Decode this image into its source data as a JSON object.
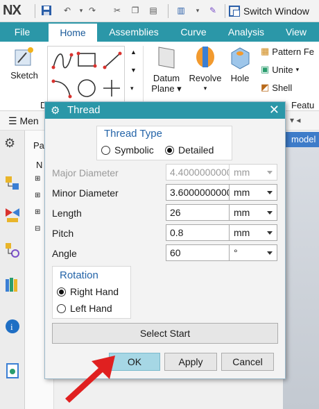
{
  "app": {
    "logo": "NX",
    "switch_window": "Switch Window"
  },
  "tabs": [
    {
      "label": "File",
      "active": false
    },
    {
      "label": "Home",
      "active": true
    },
    {
      "label": "Assemblies",
      "active": false
    },
    {
      "label": "Curve",
      "active": false
    },
    {
      "label": "Analysis",
      "active": false
    },
    {
      "label": "View",
      "active": false
    }
  ],
  "ribbon": {
    "sketch": "Sketch",
    "direct_sketch_group": "D",
    "datum_plane_line1": "Datum",
    "datum_plane_line2": "Plane",
    "revolve": "Revolve",
    "hole": "Hole",
    "pattern_feature": "Pattern Fe",
    "unite": "Unite",
    "shell": "Shell",
    "feature_group": "Featu"
  },
  "menu_row": {
    "menu_label": "Men"
  },
  "nav_panel": {
    "tab_label": "Pa",
    "column_label": "N"
  },
  "graphics": {
    "model_tab": "model"
  },
  "dialog": {
    "title": "Thread",
    "thread_type": {
      "title": "Thread Type",
      "options": [
        {
          "label": "Symbolic",
          "selected": false
        },
        {
          "label": "Detailed",
          "selected": true
        }
      ]
    },
    "fields": [
      {
        "label": "Major Diameter",
        "value": "4.4000000000000",
        "unit": "mm",
        "enabled": false
      },
      {
        "label": "Minor Diameter",
        "value": "3.6000000000000",
        "unit": "mm",
        "enabled": true
      },
      {
        "label": "Length",
        "value": "26",
        "unit": "mm",
        "enabled": true
      },
      {
        "label": "Pitch",
        "value": "0.8",
        "unit": "mm",
        "enabled": true
      },
      {
        "label": "Angle",
        "value": "60",
        "unit": "°",
        "enabled": true
      }
    ],
    "rotation": {
      "title": "Rotation",
      "options": [
        {
          "label": "Right Hand",
          "selected": true
        },
        {
          "label": "Left Hand",
          "selected": false
        }
      ]
    },
    "select_start": "Select Start",
    "buttons": {
      "ok": "OK",
      "apply": "Apply",
      "cancel": "Cancel"
    }
  },
  "colors": {
    "ribbon_accent": "#2b97a8",
    "ok_highlight": "#a6d7e5",
    "group_title": "#2464a8",
    "annotation_arrow": "#e02020"
  }
}
